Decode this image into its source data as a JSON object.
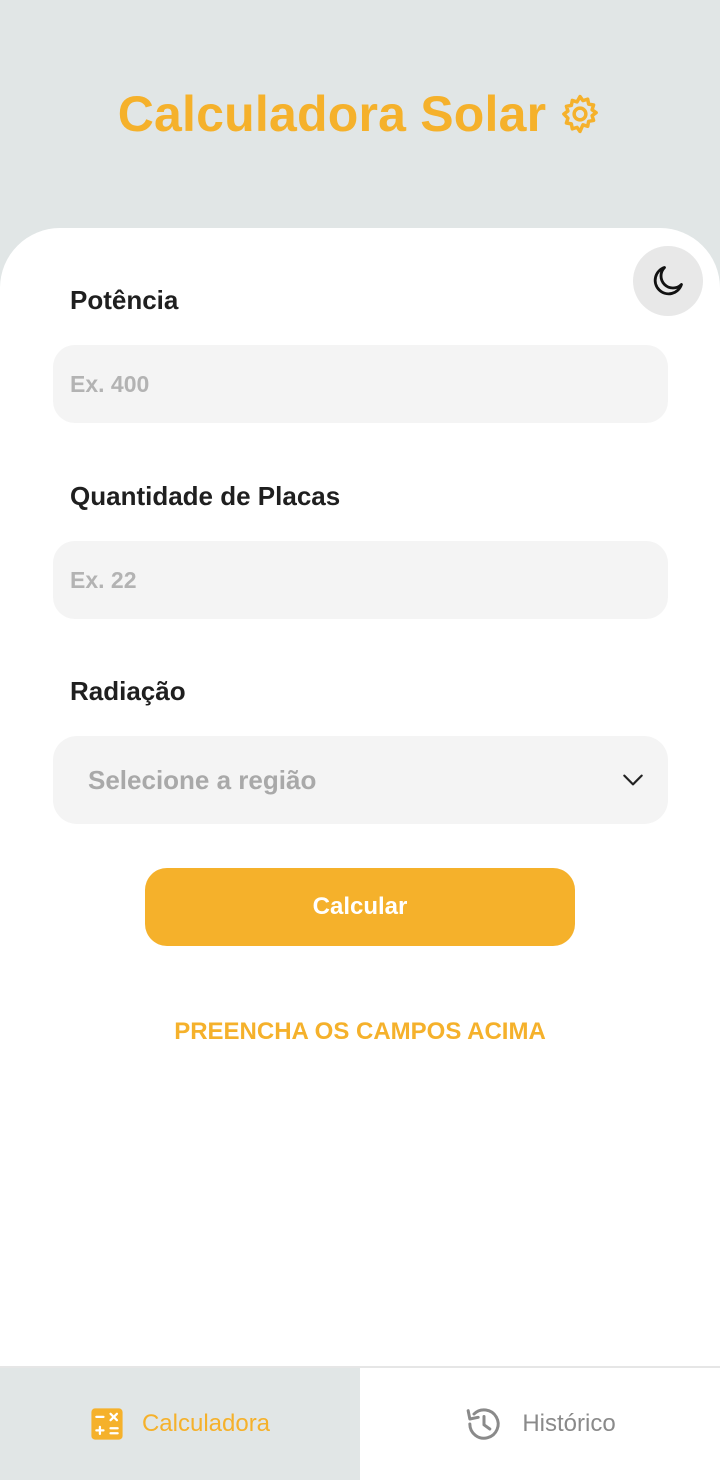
{
  "header": {
    "title": "Calculadora Solar",
    "icon": "gear-icon"
  },
  "theme_toggle": {
    "icon": "moon-icon"
  },
  "form": {
    "power": {
      "label": "Potência",
      "placeholder": "Ex. 400",
      "value": ""
    },
    "panels": {
      "label": "Quantidade de Placas",
      "placeholder": "Ex. 22",
      "value": ""
    },
    "radiation": {
      "label": "Radiação",
      "selected": "Selecione a região",
      "icon": "chevron-down-icon"
    },
    "submit_label": "Calcular"
  },
  "status": {
    "message": "PREENCHA OS CAMPOS ACIMA"
  },
  "bottom_nav": {
    "tabs": [
      {
        "label": "Calculadora",
        "icon": "calculator-icon",
        "active": true
      },
      {
        "label": "Histórico",
        "icon": "history-icon",
        "active": false
      }
    ]
  },
  "colors": {
    "accent": "#f5b12b",
    "background": "#e1e6e6",
    "card": "#ffffff",
    "input_bg": "#f4f4f4"
  }
}
